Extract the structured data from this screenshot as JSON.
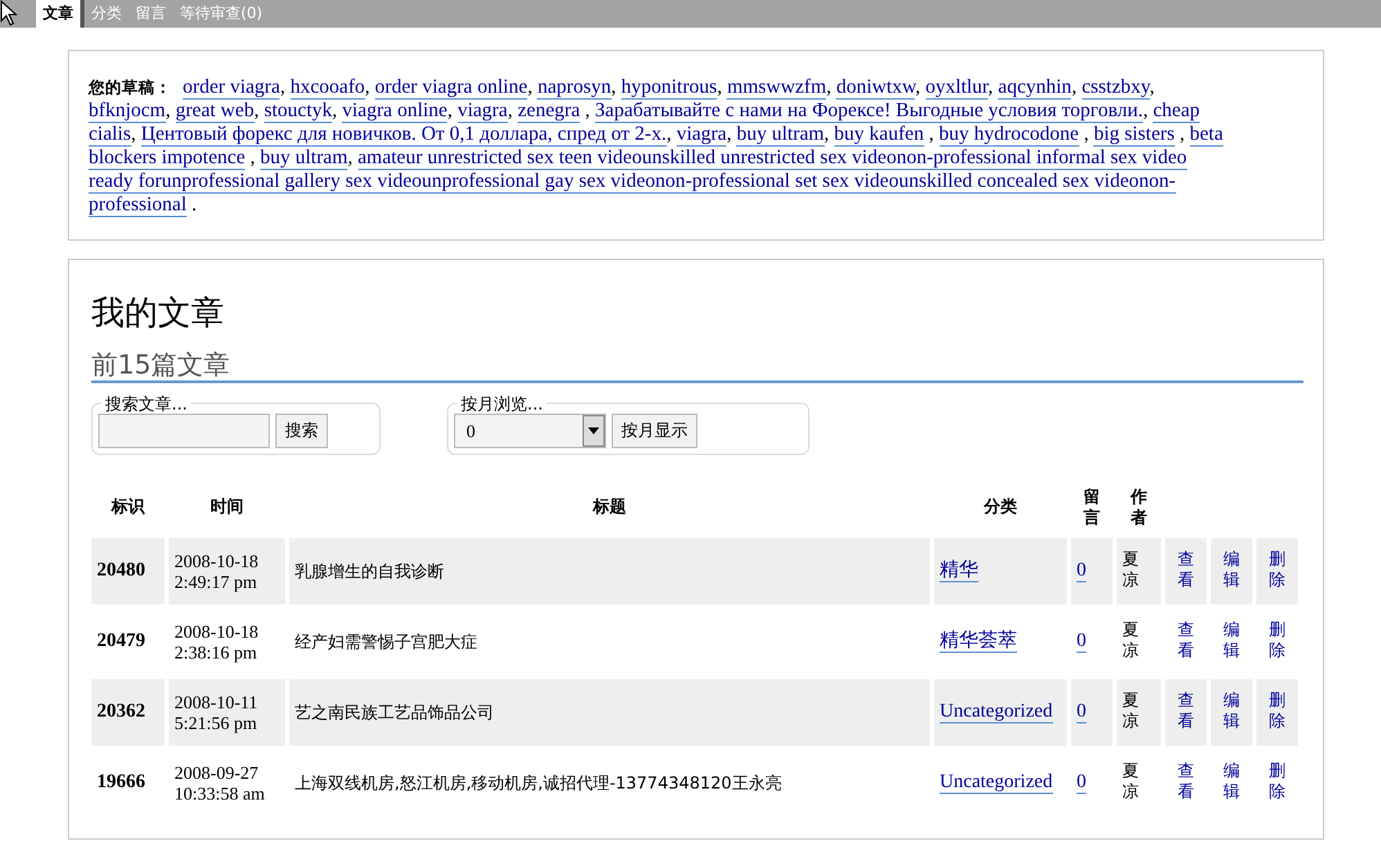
{
  "top_menu": [
    {
      "label": "文章",
      "selected": true
    },
    {
      "label": "分类",
      "selected": false
    },
    {
      "label": "留言",
      "selected": false
    },
    {
      "label": "等待审查(0)",
      "selected": false
    }
  ],
  "drafts": {
    "label": "您的草稿：",
    "lines": [
      [
        {
          "text": "order viagra",
          "sep": ","
        },
        {
          "text": "hxcooafo",
          "sep": ","
        },
        {
          "text": "order viagra online",
          "sep": ","
        },
        {
          "text": "naprosyn",
          "sep": ","
        },
        {
          "text": "hyponitrous",
          "sep": ","
        },
        {
          "text": "mmswwzfm",
          "sep": ","
        },
        {
          "text": "doniwtxw",
          "sep": ","
        },
        {
          "text": "oyxltlur",
          "sep": ","
        },
        {
          "text": "aqcynhin",
          "sep": ","
        },
        {
          "text": "csstzbxy",
          "sep": ","
        }
      ],
      [
        {
          "text": "bfknjocm",
          "sep": ","
        },
        {
          "text": "great web",
          "sep": ","
        },
        {
          "text": "stouctyk",
          "sep": ","
        },
        {
          "text": "viagra online",
          "sep": ","
        },
        {
          "text": "viagra",
          "sep": ","
        },
        {
          "text": "zenegra",
          "sep": " ,"
        },
        {
          "text": "Зарабатывайте с нами на Форексе! Выгодные условия торговли.",
          "sep": ","
        },
        {
          "text": "cheap"
        }
      ],
      [
        {
          "text": "cialis",
          "sep": ","
        },
        {
          "text": "Центовый форекс для новичков. От 0,1 доллара, спред от 2-х.",
          "sep": ","
        },
        {
          "text": "viagra",
          "sep": ","
        },
        {
          "text": "buy ultram",
          "sep": ","
        },
        {
          "text": "buy kaufen",
          "sep": " ,"
        },
        {
          "text": "buy hydrocodone",
          "sep": " ,"
        },
        {
          "text": "big sisters",
          "sep": " ,"
        },
        {
          "text": "beta"
        }
      ],
      [
        {
          "text": "blockers impotence",
          "sep": " ,"
        },
        {
          "text": "buy ultram",
          "sep": ","
        },
        {
          "text": "amateur unrestricted sex teen videounskilled unrestricted sex videonon-professional informal sex video"
        }
      ],
      [
        {
          "text": "ready forunprofessional gallery sex videounprofessional gay sex videonon-professional set sex videounskilled concealed sex videonon-"
        }
      ],
      [
        {
          "text": "professional",
          "sep": " ."
        }
      ]
    ]
  },
  "heading": "我的文章",
  "subheading": "前15篇文章",
  "search": {
    "legend": "搜索文章...",
    "button": "搜索"
  },
  "month": {
    "legend": "按月浏览...",
    "value": "0",
    "button": "按月显示"
  },
  "table": {
    "columns": [
      "标识",
      "时间",
      "标题",
      "分类",
      "留言",
      "作者"
    ],
    "rows": [
      {
        "id": "20480",
        "date": "2008-10-18",
        "time": "2:49:17 pm",
        "title": "乳腺增生的自我诊断",
        "category": "精华",
        "comments": "0",
        "author": "夏凉",
        "view": "查看",
        "edit": "编辑",
        "delete": "删除",
        "shaded": true
      },
      {
        "id": "20479",
        "date": "2008-10-18",
        "time": "2:38:16 pm",
        "title": "经产妇需警惕子宫肥大症",
        "category": "精华荟萃",
        "comments": "0",
        "author": "夏凉",
        "view": "查看",
        "edit": "编辑",
        "delete": "删除",
        "shaded": false
      },
      {
        "id": "20362",
        "date": "2008-10-11",
        "time": "5:21:56 pm",
        "title": "艺之南民族工艺品饰品公司",
        "category": "Uncategorized",
        "comments": "0",
        "author": "夏凉",
        "view": "查看",
        "edit": "编辑",
        "delete": "删除",
        "shaded": true
      },
      {
        "id": "19666",
        "date": "2008-09-27",
        "time": "10:33:58 am",
        "title": "上海双线机房,怒江机房,移动机房,诚招代理-13774348120王永亮",
        "category": "Uncategorized",
        "comments": "0",
        "author": "夏凉",
        "view": "查看",
        "edit": "编辑",
        "delete": "删除",
        "shaded": false
      }
    ]
  }
}
